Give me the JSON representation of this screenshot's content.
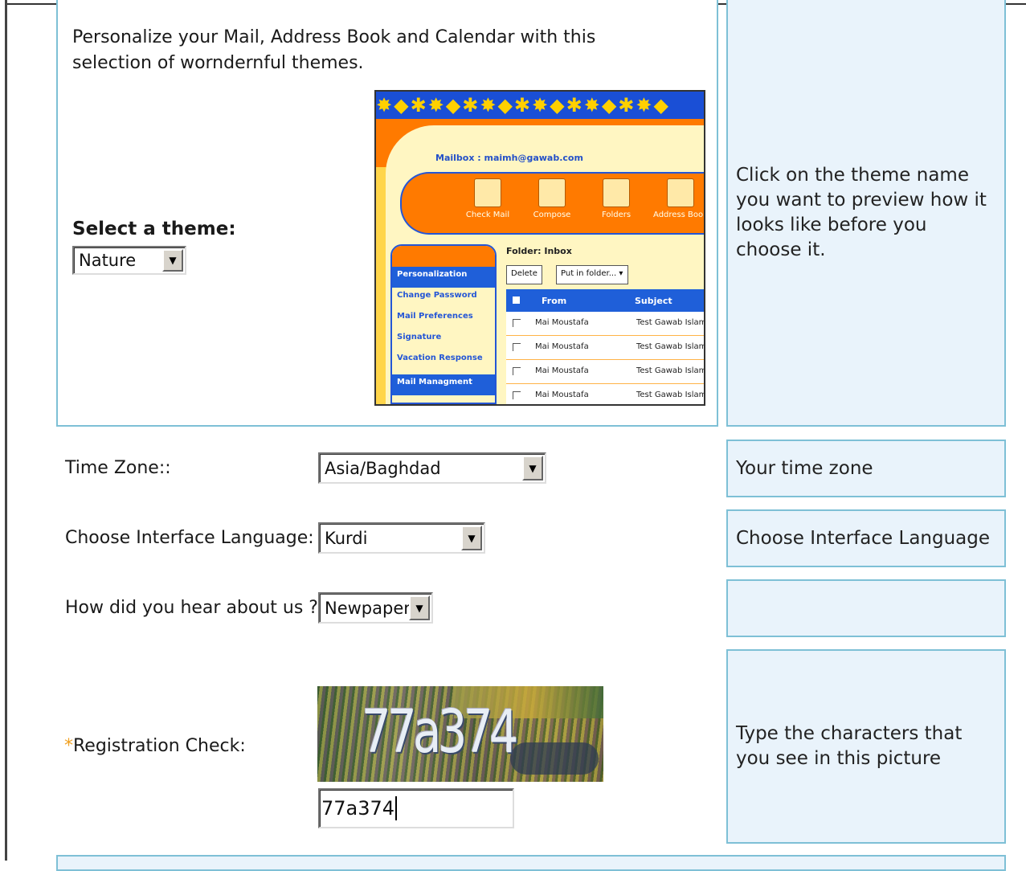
{
  "theme_panel": {
    "intro": "Personalize your Mail, Address Book and Calendar with this selection of worndernful themes.",
    "select_label": "Select a theme:",
    "select_value": "Nature",
    "help": "Click on the theme name you want to preview how it looks like before you choose it.",
    "preview": {
      "mailbox": "Mailbox : maimh@gawab.com",
      "toolbar": [
        "Check Mail",
        "Compose",
        "Folders",
        "Address Book"
      ],
      "side_items": [
        "Personalization",
        "Change Password",
        "Mail Preferences",
        "Signature",
        "Vacation Response",
        "Mail Managment"
      ],
      "folder_label": "Folder: Inbox",
      "delete_button": "Delete",
      "put_in_folder": "Put in folder...",
      "columns": [
        "From",
        "Subject"
      ],
      "rows": [
        {
          "from": "Mai Moustafa",
          "subject": "Test Gawab Islamic"
        },
        {
          "from": "Mai Moustafa",
          "subject": "Test Gawab Islamic"
        },
        {
          "from": "Mai Moustafa",
          "subject": "Test Gawab Islamic"
        },
        {
          "from": "Mai Moustafa",
          "subject": "Test Gawab Islamic"
        }
      ]
    }
  },
  "time_zone": {
    "label": "Time Zone::",
    "value": "Asia/Baghdad",
    "help": "Your time zone"
  },
  "language": {
    "label": "Choose Interface Language:",
    "value": "Kurdi",
    "help": "Choose Interface Language"
  },
  "referral": {
    "label": "How did you hear about us ?",
    "value": "Newpaper",
    "help": ""
  },
  "registration_check": {
    "required_mark": "*",
    "label": "Registration Check:",
    "captcha_text": "77a374",
    "input_value": "77a374",
    "help": "Type the characters that you see in this picture"
  },
  "colors": {
    "panel_border": "#7ec0d6",
    "help_background": "#e9f3fb",
    "required": "#f0a020"
  }
}
